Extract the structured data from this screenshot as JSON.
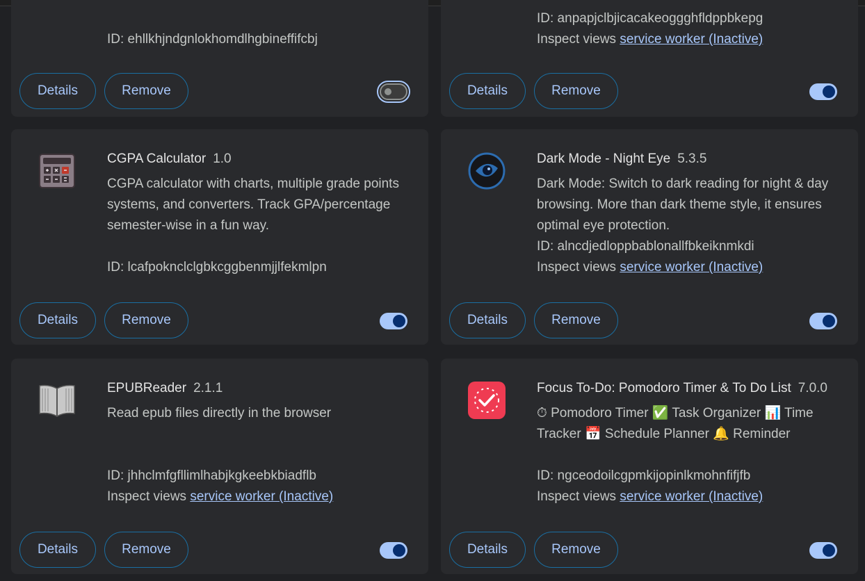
{
  "buttons": {
    "details": "Details",
    "remove": "Remove"
  },
  "inspect_label": "Inspect views",
  "cards": [
    {
      "id_text": "ID: ehllkhjndgnlokhomdlhgbineffifcbj",
      "enabled": false
    },
    {
      "id_text": "ID: anpapjclbjicacakeoggghfldppbkepg",
      "inspect_link": "service worker (Inactive)",
      "enabled": true
    },
    {
      "name": "CGPA Calculator",
      "version": "1.0",
      "description": "CGPA calculator with charts, multiple grade points systems, and converters. Track GPA/percentage semester-wise in a fun way.",
      "id_text": "ID: lcafpokncl​clgbkcggbenmjjlfekmlpn",
      "icon": "calculator-icon",
      "enabled": true
    },
    {
      "name": "Dark Mode - Night Eye",
      "version": "5.3.5",
      "description": "Dark Mode: Switch to dark reading for night & day browsing. More than dark theme style, it ensures optimal eye protection.",
      "id_text": "ID: alncdjedloppbablonallfbkeiknmkdi",
      "inspect_link": "service worker (Inactive)",
      "icon": "eye-icon",
      "enabled": true
    },
    {
      "name": "EPUBReader",
      "version": "2.1.1",
      "description": "Read epub files directly in the browser",
      "id_text": "ID: jhhclmfgfllimlhabjkgkeebkbiadflb",
      "inspect_link": "service worker (Inactive)",
      "icon": "book-icon",
      "enabled": true
    },
    {
      "name": "Focus To-Do: Pomodoro Timer & To Do List",
      "version": "7.0.0",
      "description": "⏱ Pomodoro Timer ✅ Task Organizer 📊 Time Tracker 📅 Schedule Planner 🔔 Reminder",
      "id_text": "ID: ngceodoilcgpmkijopinlkmohnfifjfb",
      "inspect_link": "service worker (Inactive)",
      "icon": "clock-check-icon",
      "enabled": true
    }
  ]
}
